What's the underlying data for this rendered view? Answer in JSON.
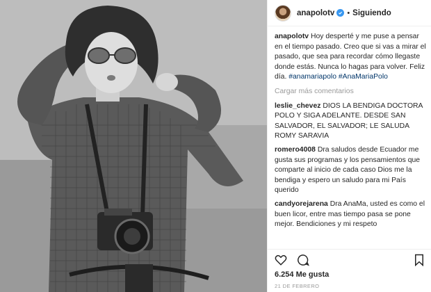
{
  "post": {
    "username": "anapolotv",
    "follow_separator": "•",
    "follow_status": "Siguiendo",
    "caption_user": "anapolotv",
    "caption_text": "Hoy desperté y me puse a pensar en el tiempo pasado. Creo que si vas a mirar el pasado, que sea para recordar cómo llegaste donde estás. Nunca lo hagas para volver. Feliz día.",
    "caption_hashtags": "#anamariapolo #AnaMariaPolo",
    "load_more": "Cargar más comentarios",
    "likes": "6.254 Me gusta",
    "date": "21 DE FEBRERO"
  },
  "comments": [
    {
      "user": "leslie_chevez",
      "text": "DIOS LA BENDIGA DOCTORA POLO Y SIGA ADELANTE. DESDE SAN SALVADOR, EL SALVADOR; LE SALUDA ROMY SARAVIA"
    },
    {
      "user": "romero4008",
      "text": "Dra saludos desde Ecuador me gusta sus programas y los pensamientos que comparte al inicio de cada caso Dios me la bendiga y espero un saludo para mi País querido"
    },
    {
      "user": "candyorejarena",
      "text": "Dra AnaMa, usted es como el buen licor, entre mas tiempo pasa se pone mejor. Bendiciones y mi respeto"
    }
  ],
  "icons": {
    "verified": "verified-badge-icon",
    "like": "heart-icon",
    "comment": "comment-bubble-icon",
    "save": "bookmark-icon",
    "verified_color": "#3897f0"
  }
}
